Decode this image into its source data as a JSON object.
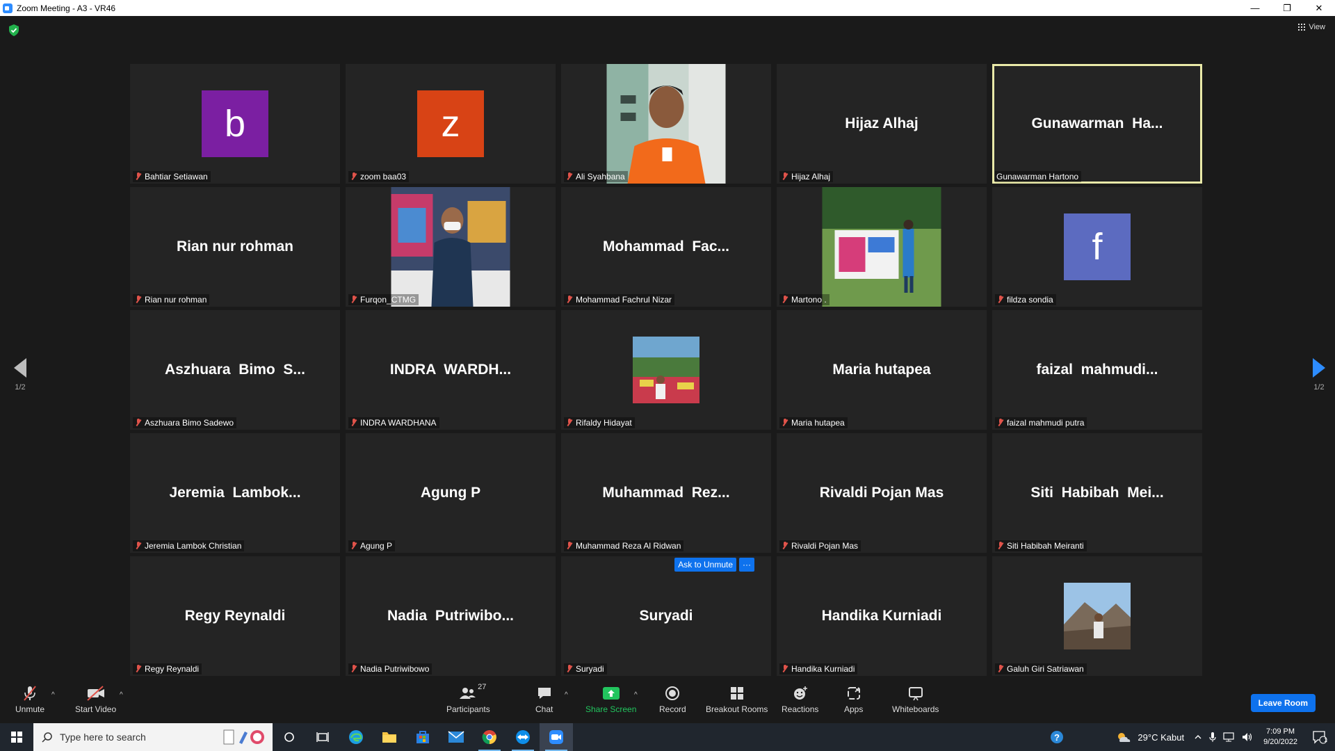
{
  "window": {
    "title": "Zoom Meeting - A3 - VR46",
    "minimize": "—",
    "restore": "❐",
    "close": "✕"
  },
  "stage": {
    "view_label": "View",
    "prev_page": "1/2",
    "next_page": "1/2"
  },
  "participants": [
    {
      "display": "b",
      "name": "Bahtiar Setiawan",
      "kind": "avatar",
      "color": "#7b1fa2"
    },
    {
      "display": "z",
      "name": "zoom baa03",
      "kind": "avatar",
      "color": "#d84315"
    },
    {
      "display": "",
      "name": "Ali Syahbana",
      "kind": "photo"
    },
    {
      "display": "Hijaz Alhaj",
      "name": "Hijaz Alhaj",
      "kind": "text"
    },
    {
      "display": "Gunawarman  Ha...",
      "name": "Gunawarman Hartono",
      "kind": "text",
      "active": true
    },
    {
      "display": "Rian nur rohman",
      "name": "Rian nur rohman",
      "kind": "text"
    },
    {
      "display": "",
      "name": "Furqon_CTMG",
      "kind": "photo"
    },
    {
      "display": "Mohammad  Fac...",
      "name": "Mohammad Fachrul Nizar",
      "kind": "text"
    },
    {
      "display": "",
      "name": "Martono .",
      "kind": "photo"
    },
    {
      "display": "f",
      "name": "fildza sondia",
      "kind": "avatar",
      "color": "#5c6bc0"
    },
    {
      "display": "Aszhuara  Bimo  S...",
      "name": "Aszhuara Bimo Sadewo",
      "kind": "text"
    },
    {
      "display": "INDRA  WARDH...",
      "name": "INDRA WARDHANA",
      "kind": "text"
    },
    {
      "display": "",
      "name": "Rifaldy Hidayat",
      "kind": "photo"
    },
    {
      "display": "Maria hutapea",
      "name": "Maria hutapea",
      "kind": "text"
    },
    {
      "display": "faizal  mahmudi...",
      "name": "faizal mahmudi putra",
      "kind": "text"
    },
    {
      "display": "Jeremia  Lambok...",
      "name": "Jeremia Lambok Christian",
      "kind": "text"
    },
    {
      "display": "Agung P",
      "name": "Agung P",
      "kind": "text"
    },
    {
      "display": "Muhammad  Rez...",
      "name": "Muhammad Reza Al Ridwan",
      "kind": "text"
    },
    {
      "display": "Rivaldi Pojan Mas",
      "name": "Rivaldi Pojan Mas",
      "kind": "text"
    },
    {
      "display": "Siti  Habibah  Mei...",
      "name": "Siti Habibah Meiranti",
      "kind": "text"
    },
    {
      "display": "Regy Reynaldi",
      "name": "Regy Reynaldi",
      "kind": "text"
    },
    {
      "display": "Nadia  Putriwibo...",
      "name": "Nadia Putriwibowo",
      "kind": "text"
    },
    {
      "display": "Suryadi",
      "name": "Suryadi",
      "kind": "text",
      "hover": true
    },
    {
      "display": "Handika Kurniadi",
      "name": "Handika Kurniadi",
      "kind": "text"
    },
    {
      "display": "",
      "name": "Galuh Giri Satriawan",
      "kind": "photo"
    }
  ],
  "hover_actions": {
    "ask_unmute": "Ask to Unmute",
    "more": "···"
  },
  "toolbar": {
    "unmute": "Unmute",
    "start_video": "Start Video",
    "participants": "Participants",
    "participants_count": "27",
    "chat": "Chat",
    "share_screen": "Share Screen",
    "record": "Record",
    "breakout": "Breakout Rooms",
    "reactions": "Reactions",
    "apps": "Apps",
    "whiteboards": "Whiteboards",
    "leave": "Leave Room",
    "caret": "^"
  },
  "taskbar": {
    "search_placeholder": "Type here to search",
    "weather": "29°C  Kabut",
    "time": "7:09 PM",
    "date": "9/20/2022",
    "notif_count": "1"
  },
  "colors": {
    "accent": "#0e72ed",
    "share_green": "#22c55e",
    "active_border": "#e9e9a8",
    "mute_red": "#e0534a"
  }
}
